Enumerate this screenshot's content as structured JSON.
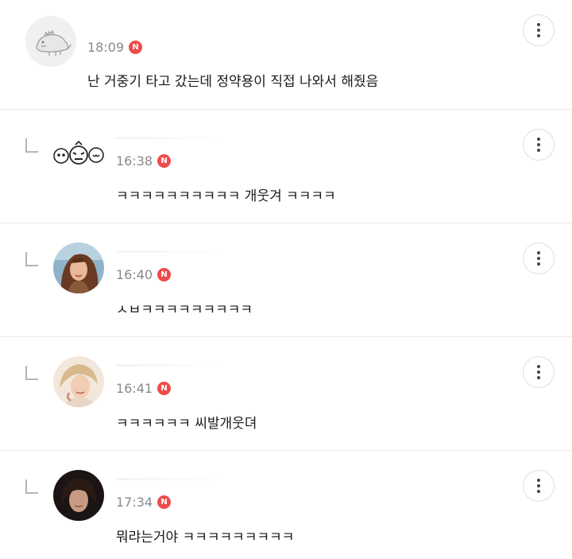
{
  "comments": [
    {
      "time": "18:09",
      "badge": "N",
      "text": "난 거중기 타고 갔는데 정약용이 직접 나와서 해줬음",
      "avatar": "dinosaur-sticker-avatar"
    },
    {
      "time": "16:38",
      "badge": "N",
      "text": "ㅋㅋㅋㅋㅋㅋㅋㅋㅋㅋ 개웃겨 ㅋㅋㅋㅋ",
      "avatar": "cartoon-faces-avatar"
    },
    {
      "time": "16:40",
      "badge": "N",
      "text": "ㅅㅂㅋㅋㅋㅋㅋㅋㅋㅋㅋ",
      "avatar": "woman-portrait-avatar"
    },
    {
      "time": "16:41",
      "badge": "N",
      "text": "ㅋㅋㅋㅋㅋㅋ 씨발개웃뎌",
      "avatar": "blonde-portrait-avatar"
    },
    {
      "time": "17:34",
      "badge": "N",
      "text": "뭐랴는거야 ㅋㅋㅋㅋㅋㅋㅋㅋㅋ",
      "avatar": "man-portrait-avatar"
    }
  ],
  "colors": {
    "badge": "#ef4b4b",
    "time": "#8a8a8a",
    "divider": "#ebebeb"
  },
  "icons": {
    "more": "vertical-dots-icon",
    "reply": "reply-corner-icon"
  }
}
